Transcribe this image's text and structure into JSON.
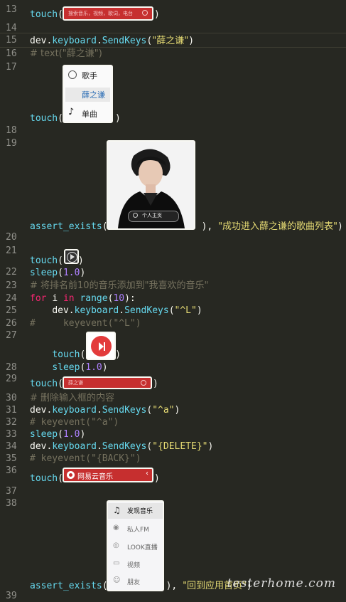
{
  "line_numbers": [
    "13",
    "14",
    "15",
    "16",
    "17",
    "18",
    "19",
    "20",
    "21",
    "22",
    "23",
    "24",
    "25",
    "26",
    "27",
    "28",
    "29",
    "30",
    "31",
    "32",
    "33",
    "34",
    "35",
    "36",
    "37",
    "38",
    "39"
  ],
  "tokens": {
    "touch": "touch",
    "dev": "dev",
    "keyboard": "keyboard",
    "sendkeys": "SendKeys",
    "assert_exists": "assert_exists",
    "sleep": "sleep",
    "for": "for",
    "i": "i",
    "in": "in",
    "range": "range"
  },
  "strings": {
    "xue": "\"薛之谦\"",
    "comment_text_xue": "# text(\"薛之谦\")",
    "success_msg": "\"成功进入薛之谦的歌曲列表\"",
    "num_1_0": "1.0",
    "comment_top10": "# 将排名前10的音乐添加到\"我喜欢的音乐\"",
    "num_10": "10",
    "ctrl_l": "\"^L\"",
    "comment_keyevent_l": "#     keyevent(\"^L\")",
    "comment_clear_input": "# 删除输入框的内容",
    "ctrl_a": "\"^a\"",
    "comment_keyevent_a": "# keyevent(\"^a\")",
    "delete": "\"{DELETE}\"",
    "comment_back": "# keyevent(\"{BACK}\")",
    "back_home_msg": "\"回到应用首页\""
  },
  "thumbs": {
    "search_bar_text": "搜索音乐，视频，歌词，电台",
    "dropdown": {
      "item1": "歌手",
      "item2": "薛之谦",
      "item3": "单曲"
    },
    "artist_profile_label": "个人主页",
    "search_bar_xue": "薛之谦",
    "app_name": "网易云音乐",
    "menu": [
      "发现音乐",
      "私人FM",
      "LOOK直播",
      "视频",
      "朋友"
    ]
  },
  "watermark": "testerhome.com",
  "colors": {
    "background": "#272822",
    "keyword": "#f92672",
    "function": "#66d9ef",
    "string": "#e6db74",
    "number": "#ae81ff",
    "comment": "#75715e",
    "netease_red": "#c62f2f"
  }
}
